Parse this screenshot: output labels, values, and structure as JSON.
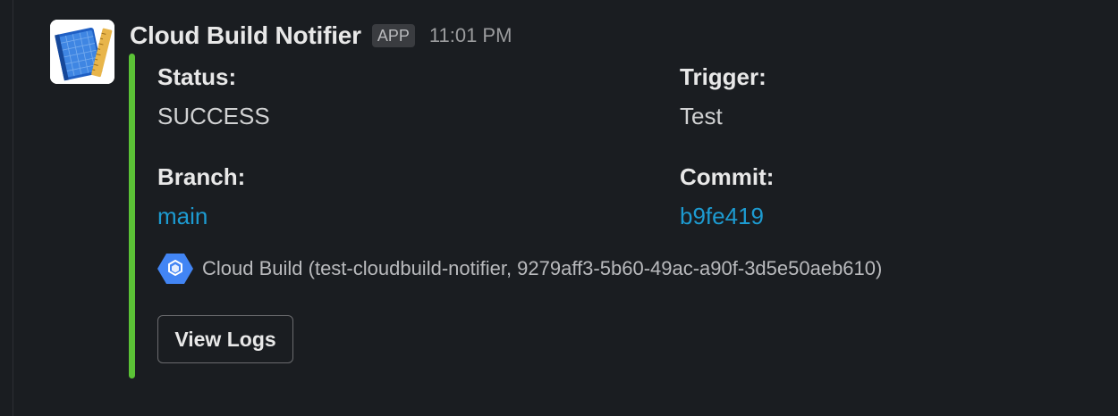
{
  "message": {
    "sender": "Cloud Build Notifier",
    "badge": "APP",
    "timestamp": "11:01 PM",
    "avatar_icon": "blueprint-ruler-icon",
    "accent_color": "#5bc236",
    "link_color": "#1d9bd1"
  },
  "fields": {
    "status": {
      "label": "Status:",
      "value": "SUCCESS"
    },
    "trigger": {
      "label": "Trigger:",
      "value": "Test"
    },
    "branch": {
      "label": "Branch:",
      "value": "main"
    },
    "commit": {
      "label": "Commit:",
      "value": "b9fe419"
    }
  },
  "context": {
    "icon": "cloud-build-icon",
    "text": "Cloud Build (test-cloudbuild-notifier, 9279aff3-5b60-49ac-a90f-3d5e50aeb610)"
  },
  "actions": {
    "view_logs_label": "View Logs"
  }
}
